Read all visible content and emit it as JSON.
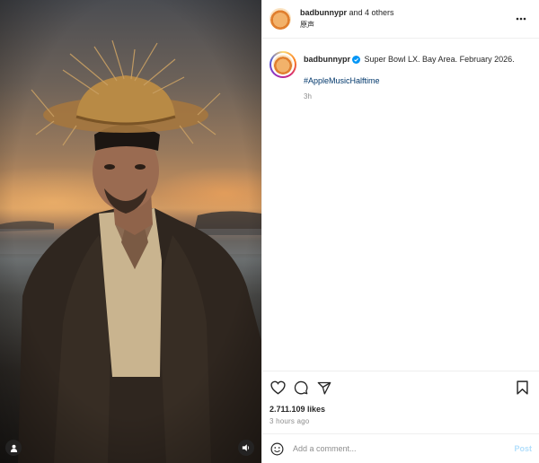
{
  "header": {
    "username": "badbunnypr",
    "collab_suffix": "and 4 others",
    "audio_label": "原声",
    "more_icon": "more-horizontal-icon"
  },
  "caption": {
    "username": "badbunnypr",
    "verified_icon": "verified-badge-icon",
    "text": "Super Bowl LX. Bay Area. February 2026.",
    "hashtag": "#AppleMusicHalftime",
    "age": "3h"
  },
  "actions": {
    "like_icon": "heart-icon",
    "comment_icon": "comment-icon",
    "share_icon": "send-icon",
    "save_icon": "bookmark-icon",
    "likes": "2.711.109 likes",
    "posted": "3 hours ago"
  },
  "comment_box": {
    "emoji_icon": "emoji-icon",
    "placeholder": "Add a comment...",
    "post_label": "Post"
  },
  "media": {
    "user_tag_icon": "user-tag-icon",
    "audio_icon": "speaker-icon"
  },
  "colors": {
    "link": "#00376b",
    "post_disabled": "#b2dffc",
    "muted": "#8e8e8e",
    "verified": "#0095f6"
  }
}
